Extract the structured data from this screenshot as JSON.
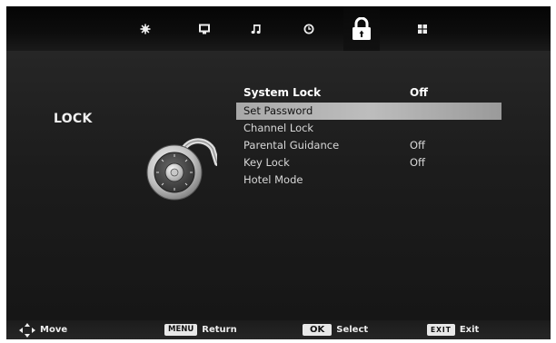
{
  "menu": {
    "title": "LOCK",
    "active_tab": "lock",
    "tabs": [
      {
        "name": "picture",
        "icon": "picture-icon"
      },
      {
        "name": "channel",
        "icon": "monitor-icon"
      },
      {
        "name": "sound",
        "icon": "music-note-icon"
      },
      {
        "name": "time",
        "icon": "clock-icon"
      },
      {
        "name": "lock",
        "icon": "padlock-icon"
      },
      {
        "name": "setup",
        "icon": "grid-icon"
      }
    ],
    "items": [
      {
        "label": "System Lock",
        "value": "Off"
      },
      {
        "label": "Set Password",
        "value": ""
      },
      {
        "label": "Channel Lock",
        "value": ""
      },
      {
        "label": "Parental Guidance",
        "value": "Off"
      },
      {
        "label": "Key Lock",
        "value": "Off"
      },
      {
        "label": "Hotel Mode",
        "value": ""
      }
    ],
    "selected_index": 1
  },
  "footer": {
    "move": {
      "label": "Move",
      "icon": "dpad-icon"
    },
    "return": {
      "key": "MENU",
      "label": "Return"
    },
    "select": {
      "key": "OK",
      "label": "Select"
    },
    "exit": {
      "key": "EXIT",
      "label": "Exit"
    }
  },
  "colors": {
    "background": "#1c1c1c",
    "highlight": "#b4b4b4",
    "text": "#ffffff"
  }
}
